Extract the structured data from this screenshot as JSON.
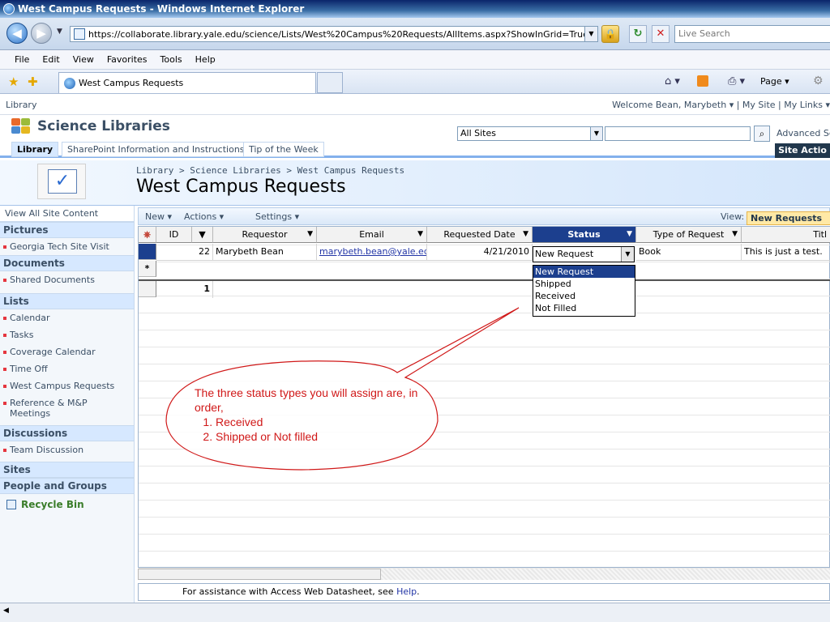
{
  "window": {
    "title": "West Campus Requests - Windows Internet Explorer"
  },
  "address": {
    "url": "https://collaborate.library.yale.edu/science/Lists/West%20Campus%20Requests/AllItems.aspx?ShowInGrid=True&Vi",
    "search_placeholder": "Live Search"
  },
  "menu": [
    "File",
    "Edit",
    "View",
    "Favorites",
    "Tools",
    "Help"
  ],
  "tab": {
    "label": "West Campus Requests"
  },
  "commandbar": {
    "page_label": "Page ▾"
  },
  "sharepoint": {
    "site_label": "Library",
    "welcome": "Welcome Bean, Marybeth ▾  |  My Site  |  My Links ▾",
    "site_title": "Science Libraries",
    "search_scope": "All Sites",
    "advanced_search": "Advanced Se",
    "nav_tabs": [
      "Library",
      "SharePoint Information and Instructions",
      "Tip of the Week"
    ],
    "site_actions": "Site Actio",
    "breadcrumb": "Library > Science Libraries > West Campus Requests",
    "page_title": "West Campus Requests"
  },
  "leftnav": {
    "view_all": "View All Site Content",
    "sections": [
      {
        "heading": "Pictures",
        "items": [
          "Georgia Tech Site Visit"
        ]
      },
      {
        "heading": "Documents",
        "items": [
          "Shared Documents"
        ]
      },
      {
        "heading": "Lists",
        "items": [
          "Calendar",
          "Tasks",
          "Coverage Calendar",
          "Time Off",
          "West Campus Requests",
          "Reference & M&P Meetings"
        ]
      },
      {
        "heading": "Discussions",
        "items": [
          "Team Discussion"
        ]
      },
      {
        "heading": "Sites",
        "items": []
      },
      {
        "heading": "People and Groups",
        "items": []
      }
    ],
    "recycle_bin": "Recycle Bin"
  },
  "toolbar": {
    "new": "New ▾",
    "actions": "Actions ▾",
    "settings": "Settings ▾",
    "view_label": "View:",
    "view_value": "New Requests"
  },
  "grid": {
    "columns": [
      "ID",
      "Requestor",
      "Email",
      "Requested Date",
      "Status",
      "Type of Request",
      "Titl"
    ],
    "row": {
      "id": "22",
      "requestor": "Marybeth Bean",
      "email": "marybeth.bean@yale.edu",
      "date": "4/21/2010",
      "status": "New Request",
      "type": "Book",
      "title": "This is just a test."
    },
    "new_row_marker": "*",
    "total_count": "1",
    "status_options": [
      "New Request",
      "Shipped",
      "Received",
      "Not Filled"
    ]
  },
  "assist": {
    "text": "For assistance with Access Web Datasheet, see ",
    "link": "Help",
    "after": "."
  },
  "callout": {
    "intro": "The three status types you will assign are, in order,",
    "items": [
      "Received",
      "Shipped or Not filled"
    ]
  }
}
